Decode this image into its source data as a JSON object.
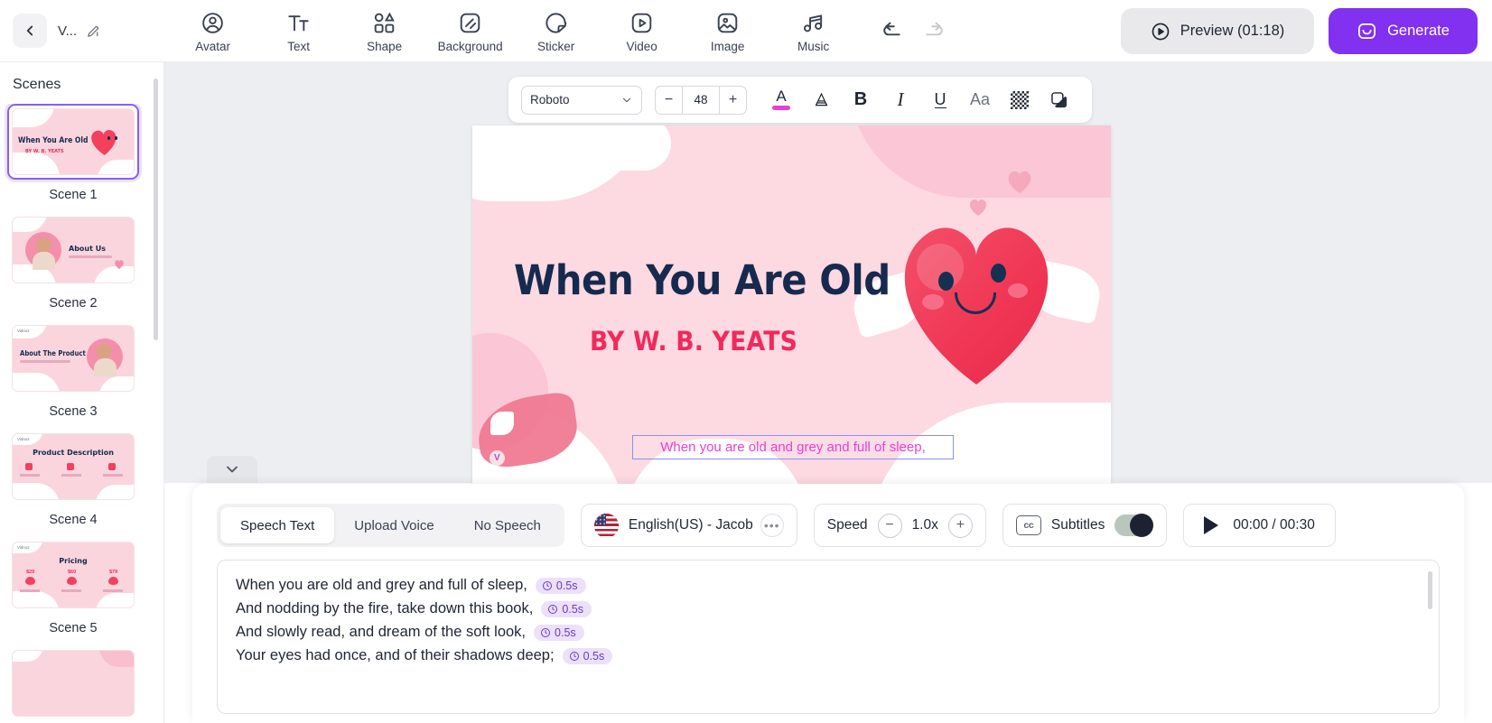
{
  "topbar": {
    "back_icon": "chevron-left-icon",
    "project_title": "V...",
    "edit_icon": "pencil-icon",
    "tools": [
      {
        "label": "Avatar",
        "icon": "avatar-icon"
      },
      {
        "label": "Text",
        "icon": "text-icon"
      },
      {
        "label": "Shape",
        "icon": "shape-icon"
      },
      {
        "label": "Background",
        "icon": "background-icon"
      },
      {
        "label": "Sticker",
        "icon": "sticker-icon"
      },
      {
        "label": "Video",
        "icon": "video-icon"
      },
      {
        "label": "Image",
        "icon": "image-icon"
      },
      {
        "label": "Music",
        "icon": "music-icon"
      }
    ],
    "undo_icon": "undo-icon",
    "redo_icon": "redo-icon",
    "preview_label": "Preview (01:18)",
    "preview_icon": "play-circle-icon",
    "generate_label": "Generate",
    "generate_icon": "sparkle-box-icon",
    "generate_color": "#8131ef"
  },
  "sidebar": {
    "title": "Scenes",
    "scenes": [
      {
        "label": "Scene 1",
        "active": true,
        "thumb_title": "When You Are Old",
        "thumb_sub": "BY W. B. YEATS"
      },
      {
        "label": "Scene 2",
        "active": false,
        "thumb_title": "About Us",
        "thumb_sub": ""
      },
      {
        "label": "Scene 3",
        "active": false,
        "thumb_title": "About The Product",
        "thumb_sub": ""
      },
      {
        "label": "Scene 4",
        "active": false,
        "thumb_title": "Product Description",
        "thumb_sub": ""
      },
      {
        "label": "Scene 5",
        "active": false,
        "thumb_title": "Pricing",
        "thumb_sub": ""
      }
    ]
  },
  "format_toolbar": {
    "font_family": "Roboto",
    "font_size": "48",
    "decrease_label": "−",
    "increase_label": "+",
    "text_color_swatch": "#e83fd2",
    "buttons": [
      {
        "name": "text-color-icon",
        "glyph": "A"
      },
      {
        "name": "text-outline-icon",
        "glyph": "A"
      },
      {
        "name": "bold-icon",
        "glyph": "B"
      },
      {
        "name": "italic-icon",
        "glyph": "I"
      },
      {
        "name": "underline-icon",
        "glyph": "U"
      },
      {
        "name": "text-case-icon",
        "glyph": "Aa"
      },
      {
        "name": "texture-icon",
        "glyph": ""
      },
      {
        "name": "shadow-icon",
        "glyph": ""
      }
    ]
  },
  "canvas": {
    "slide_title": "When You Are Old",
    "slide_subtitle": "BY W. B. YEATS",
    "selected_textbox": "When you are old and grey and full of sleep,",
    "selection_color": "#8a8ff0",
    "subtitle_text_color": "#e83fd2",
    "collapse_icon": "chevron-down-icon",
    "watermark": "Vidnoz"
  },
  "bottom_panel": {
    "tabs": [
      {
        "label": "Speech Text",
        "active": true
      },
      {
        "label": "Upload Voice",
        "active": false
      },
      {
        "label": "No Speech",
        "active": false
      }
    ],
    "voice": {
      "flag": "us-flag-icon",
      "name": "English(US) - Jacob",
      "more_label": "•••"
    },
    "speed": {
      "label": "Speed",
      "value": "1.0x",
      "minus": "−",
      "plus": "+"
    },
    "subtitles": {
      "icon_label": "cc",
      "label": "Subtitles",
      "enabled": true
    },
    "player": {
      "play_icon": "play-icon",
      "time": "00:00 / 00:30"
    },
    "speech_lines": [
      {
        "text": "When you are old and grey and full of sleep,",
        "pause": "0.5s"
      },
      {
        "text": "And nodding by the fire, take down this book,",
        "pause": "0.5s"
      },
      {
        "text": "And slowly read, and dream of the soft look,",
        "pause": "0.5s"
      },
      {
        "text": "Your eyes had once, and of their shadows deep;",
        "pause": "0.5s"
      }
    ]
  }
}
